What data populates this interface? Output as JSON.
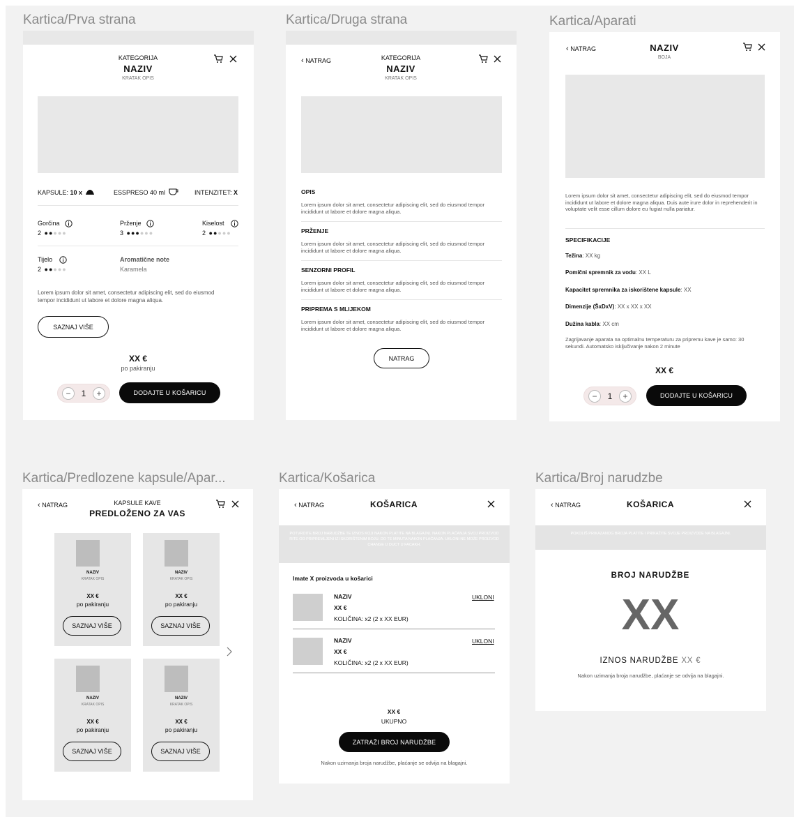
{
  "frames": {
    "f1": {
      "title": "Kartica/Prva strana",
      "category": "KATEGORIJA",
      "name": "NAZIV",
      "short": "KRATAK OPIS",
      "capsules_label": "KAPSULE:",
      "capsules_value": "10 x",
      "espresso": "ESSPRESO 40 ml",
      "intensity_label": "INTENZITET:",
      "intensity_value": "X",
      "gorcina": "Gorčina",
      "gorcina_n": "2",
      "przenje": "Prženje",
      "przenje_n": "3",
      "kiselost": "Kiselost",
      "kiselost_n": "2",
      "tijelo": "Tijelo",
      "tijelo_n": "2",
      "aroma": "Aromatične note",
      "aroma_v": "Karamela",
      "desc": "Lorem ipsum dolor sit amet, consectetur adipiscing elit, sed do eiusmod tempor incididunt ut labore et dolore magna aliqua.",
      "more": "SAZNAJ VIŠE",
      "price": "XX €",
      "per": "po pakiranju",
      "qty": "1",
      "minus": "−",
      "plus": "+",
      "add": "DODAJTE U KOŠARICU"
    },
    "f2": {
      "title": "Kartica/Druga strana",
      "back": "NATRAG",
      "category": "KATEGORIJA",
      "name": "NAZIV",
      "short": "KRATAK OPIS",
      "sections": [
        {
          "h": "OPIS",
          "t": "Lorem ipsum dolor sit amet, consectetur adipiscing elit, sed do eiusmod tempor incididunt ut labore et dolore magna aliqua."
        },
        {
          "h": "PRŽENJE",
          "t": "Lorem ipsum dolor sit amet, consectetur adipiscing elit, sed do eiusmod tempor incididunt ut labore et dolore magna aliqua."
        },
        {
          "h": "SENZORNI PROFIL",
          "t": "Lorem ipsum dolor sit amet, consectetur adipiscing elit, sed do eiusmod tempor incididunt ut labore et dolore magna aliqua."
        },
        {
          "h": "PRIPREMA S MLIJEKOM",
          "t": "Lorem ipsum dolor sit amet, consectetur adipiscing elit, sed do eiusmod tempor incididunt ut labore et dolore magna aliqua."
        }
      ],
      "back_btn": "NATRAG"
    },
    "f3": {
      "title": "Kartica/Aparati",
      "back": "NATRAG",
      "name": "NAZIV",
      "color": "BOJA",
      "desc": "Lorem ipsum dolor sit amet, consectetur adipiscing elit, sed do eiusmod tempor incididunt ut labore et dolore magna aliqua. Duis aute irure dolor in reprehenderit in voluptate velit esse cillum dolore eu fugiat nulla pariatur.",
      "spec_h": "SPECIFIKACIJE",
      "specs": [
        {
          "k": "Težina",
          "v": ": XX kg"
        },
        {
          "k": "Pomični spremnik za vodu",
          "v": ": XX L"
        },
        {
          "k": "Kapacitet spremnika za iskorištene kapsule",
          "v": ": XX"
        },
        {
          "k": "Dimenzije (ŠxDxV)",
          "v": ": XX x XX x XX"
        },
        {
          "k": "Dužina kabla",
          "v": ": XX cm"
        }
      ],
      "note": "Zagrijavanje aparata na optimalnu temperaturu za pripremu kave je samo: 30 sekundi. Automatsko isključivanje nakon 2 minute",
      "price": "XX €",
      "qty": "1",
      "minus": "−",
      "plus": "+",
      "add": "DODAJTE U KOŠARICU"
    },
    "f4": {
      "title": "Kartica/Predlozene kapsule/Apar...",
      "back": "NATRAG",
      "sub": "KAPSULE KAVE",
      "heading": "PREDLOŽENO ZA VAS",
      "cards": [
        {
          "name": "NAZIV",
          "short": "KRATAK OPIS",
          "price": "XX €",
          "per": "po pakiranju",
          "more": "SAZNAJ VIŠE"
        },
        {
          "name": "NAZIV",
          "short": "KRATAK OPIS",
          "price": "XX €",
          "per": "po pakiranju",
          "more": "SAZNAJ VIŠE"
        },
        {
          "name": "NAZIV",
          "short": "KRATAK OPIS",
          "price": "XX €",
          "per": "po pakiranju",
          "more": "SAZNAJ VIŠE"
        },
        {
          "name": "NAZIV",
          "short": "KRATAK OPIS",
          "price": "XX €",
          "per": "po pakiranju",
          "more": "SAZNAJ VIŠE"
        }
      ]
    },
    "f5": {
      "title": "Kartica/Košarica",
      "back": "NATRAG",
      "heading": "KOŠARICA",
      "banner": "POTVRDITE BROJ NARUDŽBE TE IZNOS KOJI NAKON PLATITE NA BLAGAJNI. NAKON PLAĆANJA SVOJ PROIZVOD RITE OD PRIPREMLJENI IZ ISKORIŠTENIM BOJU. DO TE MINUTA NAKON PLAĆANJA. UKLONI NE MOŽE PROIZVOD CHANGE U DUCT U FACAKH.",
      "count": "Imate X proizvoda u košarici",
      "items": [
        {
          "name": "NAZIV",
          "price": "XX €",
          "qty": "KOLIČINA: x2 (2 x XX EUR)",
          "remove": "UKLONI"
        },
        {
          "name": "NAZIV",
          "price": "XX €",
          "qty": "KOLIČINA: x2 (2 x XX EUR)",
          "remove": "UKLONI"
        }
      ],
      "total": "XX €",
      "total_label": "UKUPNO",
      "order_btn": "ZATRAŽI BROJ NARUDŽBE",
      "footer": "Nakon uzimanja broja narudžbe, plaćanje se odvija na blagajni."
    },
    "f6": {
      "title": "Kartica/Broj narudzbe",
      "back": "NATRAG",
      "heading": "KOŠARICA",
      "banner": "POKOLIŠ PRIKAZANOG BROJA PLATITE I PRIKAŽITE SVOJE PROIZVODE NA BLAGAJNI.",
      "order_h": "BROJ NARUDŽBE",
      "order_no": "XX",
      "amount_label": "IZNOS NARUDŽBE",
      "amount": "XX €",
      "footer": "Nakon uzimanja broja narudžbe, plaćanje se odvija na blagajni."
    }
  },
  "icons": {
    "cart": "cart-icon",
    "close": "close-icon",
    "back": "chevron-left-icon",
    "info": "info-icon",
    "next": "chevron-right-icon",
    "capsule": "capsule-icon",
    "cup": "cup-icon"
  }
}
